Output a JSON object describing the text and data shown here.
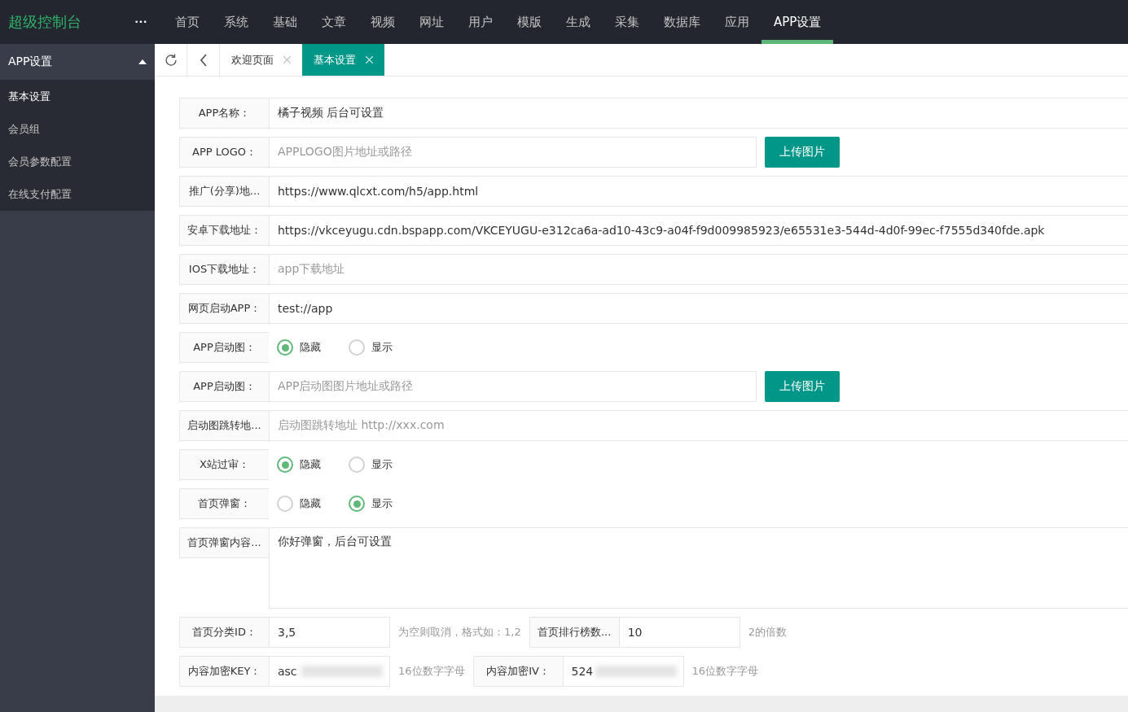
{
  "brand": "超级控制台",
  "more": "•••",
  "nav": [
    {
      "label": "首页",
      "selected": false
    },
    {
      "label": "系统",
      "selected": false
    },
    {
      "label": "基础",
      "selected": false
    },
    {
      "label": "文章",
      "selected": false
    },
    {
      "label": "视频",
      "selected": false
    },
    {
      "label": "网址",
      "selected": false
    },
    {
      "label": "用户",
      "selected": false
    },
    {
      "label": "模版",
      "selected": false
    },
    {
      "label": "生成",
      "selected": false
    },
    {
      "label": "采集",
      "selected": false
    },
    {
      "label": "数据库",
      "selected": false
    },
    {
      "label": "应用",
      "selected": false
    },
    {
      "label": "APP设置",
      "selected": true
    }
  ],
  "sidebar": {
    "title": "APP设置",
    "expanded": true,
    "items": [
      {
        "label": "基本设置",
        "selected": true
      },
      {
        "label": "会员组",
        "selected": false
      },
      {
        "label": "会员参数配置",
        "selected": false
      },
      {
        "label": "在线支付配置",
        "selected": false
      }
    ]
  },
  "tabs": [
    {
      "label": "欢迎页面",
      "selected": false
    },
    {
      "label": "基本设置",
      "selected": true
    }
  ],
  "form": {
    "rows": [
      {
        "kind": "text",
        "label": "APP名称：",
        "value": "橘子视频 后台可设置"
      },
      {
        "kind": "upload",
        "label": "APP LOGO：",
        "placeholder": "APPLOGO图片地址或路径",
        "button": "上传图片"
      },
      {
        "kind": "text",
        "label": "推广(分享)地...",
        "value": "https://www.qlcxt.com/h5/app.html"
      },
      {
        "kind": "text",
        "label": "安卓下载地址：",
        "value": "https://vkceyugu.cdn.bspapp.com/VKCEYUGU-e312ca6a-ad10-43c9-a04f-f9d009985923/e65531e3-544d-4d0f-99ec-f7555d340fde.apk"
      },
      {
        "kind": "text",
        "label": "IOS下载地址：",
        "placeholder": "app下载地址"
      },
      {
        "kind": "text",
        "label": "网页启动APP：",
        "value": "test://app"
      },
      {
        "kind": "radio",
        "label": "APP启动图：",
        "options": [
          {
            "label": "隐藏",
            "selected": true
          },
          {
            "label": "显示",
            "selected": false
          }
        ]
      },
      {
        "kind": "upload",
        "label": "APP启动图：",
        "placeholder": "APP启动图图片地址或路径",
        "button": "上传图片"
      },
      {
        "kind": "text",
        "label": "启动图跳转地...",
        "placeholder": "启动图跳转地址 http://xxx.com"
      },
      {
        "kind": "radio",
        "label": "X站过审：",
        "options": [
          {
            "label": "隐藏",
            "selected": true
          },
          {
            "label": "显示",
            "selected": false
          }
        ]
      },
      {
        "kind": "radio",
        "label": "首页弹窗：",
        "options": [
          {
            "label": "隐藏",
            "selected": false
          },
          {
            "label": "显示",
            "selected": true
          }
        ]
      },
      {
        "kind": "textarea",
        "label": "首页弹窗内容...",
        "value": "你好弹窗，后台可设置"
      }
    ],
    "inline_rows": [
      [
        {
          "label": "首页分类ID：",
          "value": "3,5",
          "hint": "为空则取消，格式如：1,2"
        },
        {
          "label": "首页排行榜数...",
          "value": "10",
          "hint": "2的倍数"
        }
      ],
      [
        {
          "label": "内容加密KEY：",
          "value": "asc",
          "blurred": true,
          "hint": "16位数字字母"
        },
        {
          "label": "内容加密IV：",
          "value": "524",
          "blurred": true,
          "hint": "16位数字字母"
        }
      ]
    ]
  }
}
